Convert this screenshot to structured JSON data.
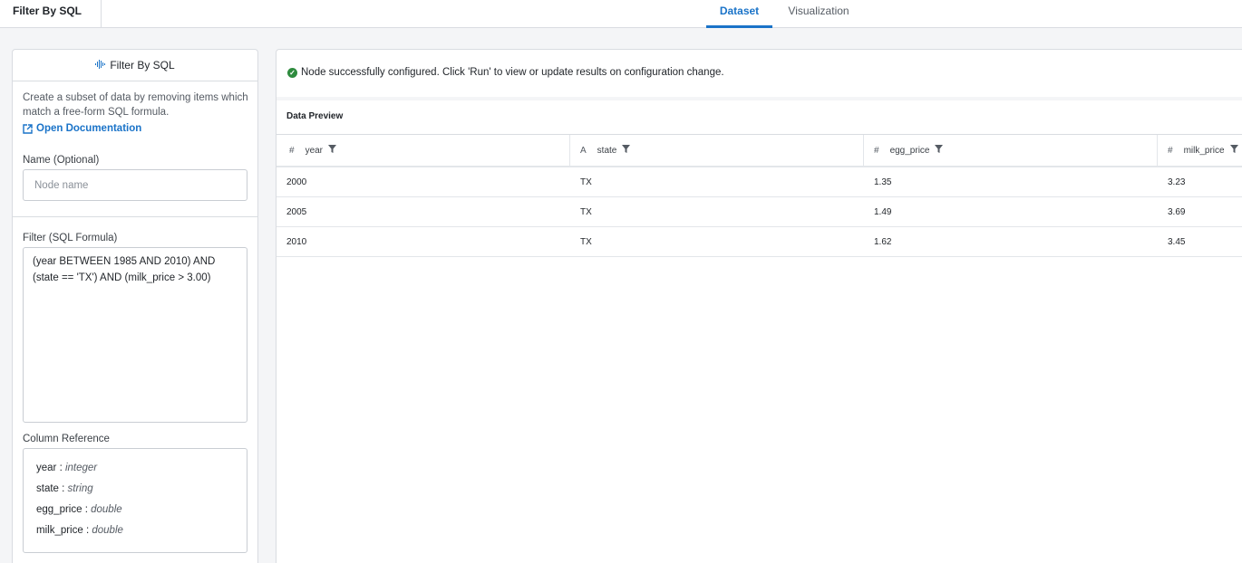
{
  "topbar": {
    "node_tab": "Filter By SQL",
    "tabs": [
      {
        "label": "Dataset",
        "active": true
      },
      {
        "label": "Visualization",
        "active": false
      }
    ]
  },
  "left_panel": {
    "title": "Filter By SQL",
    "description": "Create a subset of data by removing items which match a free-form SQL formula.",
    "doc_link": "Open Documentation",
    "name_label": "Name (Optional)",
    "name_placeholder": "Node name",
    "filter_label": "Filter (SQL Formula)",
    "filter_value": "(year BETWEEN 1985 AND 2010) AND (state == 'TX') AND (milk_price > 3.00)",
    "column_ref_label": "Column Reference",
    "columns": [
      {
        "name": "year",
        "type": "integer"
      },
      {
        "name": "state",
        "type": "string"
      },
      {
        "name": "egg_price",
        "type": "double"
      },
      {
        "name": "milk_price",
        "type": "double"
      }
    ]
  },
  "right_panel": {
    "status": "Node successfully configured. Click 'Run' to view or update results on configuration change.",
    "preview_title": "Data Preview",
    "columns": [
      {
        "symbol": "#",
        "name": "year"
      },
      {
        "symbol": "A",
        "name": "state"
      },
      {
        "symbol": "#",
        "name": "egg_price"
      },
      {
        "symbol": "#",
        "name": "milk_price"
      }
    ],
    "rows": [
      [
        "2000",
        "TX",
        "1.35",
        "3.23"
      ],
      [
        "2005",
        "TX",
        "1.49",
        "3.69"
      ],
      [
        "2010",
        "TX",
        "1.62",
        "3.45"
      ]
    ]
  },
  "colors": {
    "accent": "#1a73c8",
    "success": "#2e8b3e"
  }
}
